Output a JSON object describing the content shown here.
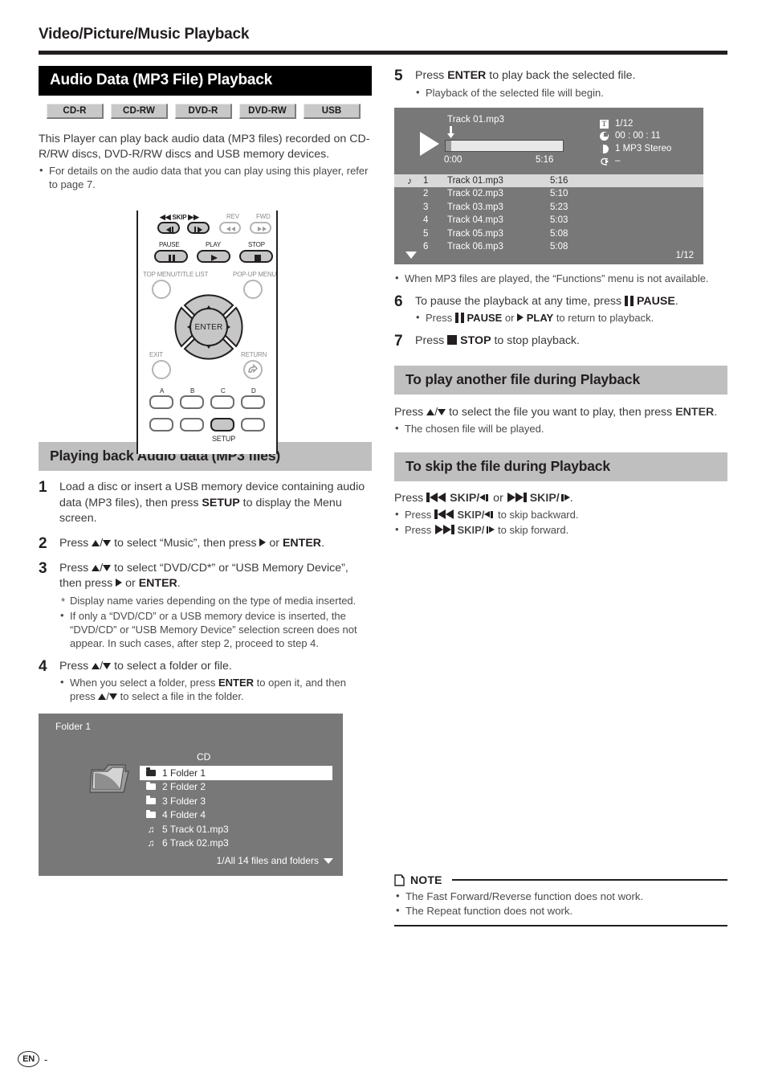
{
  "header": {
    "chapter_title": "Video/Picture/Music Playback"
  },
  "left_column": {
    "section_title": "Audio Data (MP3 File) Playback",
    "media_badges": [
      "CD-R",
      "CD-RW",
      "DVD-R",
      "DVD-RW",
      "USB"
    ],
    "intro_paragraph": "This Player can play back audio data (MP3 files) recorded on CD-R/RW discs, DVD-R/RW discs and USB memory devices.",
    "intro_bullets": [
      "For details on the audio data that you can play using this player, refer to page 7."
    ],
    "remote": {
      "labels": {
        "skip": "SKIP",
        "rev": "REV",
        "fwd": "FWD",
        "pause": "PAUSE",
        "play": "PLAY",
        "stop": "STOP",
        "top_menu": "TOP MENU/TITLE LIST",
        "popup_menu": "POP-UP MENU",
        "exit": "EXIT",
        "return": "RETURN",
        "enter": "ENTER",
        "setup": "SETUP",
        "color_a": "A",
        "color_b": "B",
        "color_c": "C",
        "color_d": "D"
      }
    },
    "procedure_title": "Playing back Audio data (MP3 files)",
    "steps": [
      {
        "num": "1",
        "text_parts": [
          {
            "t": "Load a disc or insert a USB memory device containing audio data (MP3 files), then press ",
            "b": false
          },
          {
            "t": "SETUP",
            "b": true
          },
          {
            "t": " to display the Menu screen.",
            "b": false
          }
        ]
      },
      {
        "num": "2",
        "text_parts": [
          {
            "t": "Press ",
            "b": false
          },
          {
            "t": "__UP__",
            "b": false
          },
          {
            "t": "/",
            "b": false
          },
          {
            "t": "__DOWN__",
            "b": false
          },
          {
            "t": " to select “Music”, then press ",
            "b": false
          },
          {
            "t": "__RIGHT__",
            "b": false
          },
          {
            "t": " or ",
            "b": false
          },
          {
            "t": "ENTER",
            "b": true
          },
          {
            "t": ".",
            "b": false
          }
        ]
      },
      {
        "num": "3",
        "text_parts": [
          {
            "t": "Press ",
            "b": false
          },
          {
            "t": "__UP__",
            "b": false
          },
          {
            "t": "/",
            "b": false
          },
          {
            "t": "__DOWN__",
            "b": false
          },
          {
            "t": " to select “DVD/CD*” or “USB Memory Device”, then press ",
            "b": false
          },
          {
            "t": "__RIGHT__",
            "b": false
          },
          {
            "t": " or ",
            "b": false
          },
          {
            "t": "ENTER",
            "b": true
          },
          {
            "t": ".",
            "b": false
          }
        ],
        "sub_star": "Display name varies depending on the type of media inserted.",
        "sub_bullets": [
          "If only a “DVD/CD” or a USB memory device is inserted, the “DVD/CD” or “USB Memory Device” selection screen does not appear. In such cases, after step 2, proceed to step 4."
        ]
      },
      {
        "num": "4",
        "text_parts": [
          {
            "t": "Press ",
            "b": false
          },
          {
            "t": "__UP__",
            "b": false
          },
          {
            "t": "/",
            "b": false
          },
          {
            "t": "__DOWN__",
            "b": false
          },
          {
            "t": " to select a folder or file.",
            "b": false
          }
        ],
        "sub_bullets_rich": [
          [
            {
              "t": "When you select a folder, press ",
              "b": false
            },
            {
              "t": "ENTER",
              "b": true
            },
            {
              "t": " to open it, and then press ",
              "b": false
            },
            {
              "t": "__UP__",
              "b": false
            },
            {
              "t": "/",
              "b": false
            },
            {
              "t": "__DOWN__",
              "b": false
            },
            {
              "t": " to select a file in the folder.",
              "b": false
            }
          ]
        ]
      }
    ],
    "folder_osd": {
      "title": "Folder 1",
      "source_label": "CD",
      "rows": [
        {
          "icon": "folder-icon",
          "label": "1 Folder 1",
          "selected": true
        },
        {
          "icon": "folder-icon",
          "label": "2 Folder 2",
          "selected": false
        },
        {
          "icon": "folder-icon",
          "label": "3 Folder 3",
          "selected": false
        },
        {
          "icon": "folder-icon",
          "label": "4 Folder 4",
          "selected": false
        },
        {
          "icon": "music-note-icon",
          "label": "5 Track 01.mp3",
          "selected": false
        },
        {
          "icon": "music-note-icon",
          "label": "6 Track 02.mp3",
          "selected": false
        }
      ],
      "footer": "1/All 14 files and folders"
    }
  },
  "right_column": {
    "steps": [
      {
        "num": "5",
        "text_parts": [
          {
            "t": "Press ",
            "b": false
          },
          {
            "t": "ENTER",
            "b": true
          },
          {
            "t": " to play back the selected file.",
            "b": false
          }
        ],
        "sub_bullets": [
          "Playback of the selected file will begin."
        ]
      }
    ],
    "player_osd": {
      "now_playing": "Track 01.mp3",
      "time_elapsed": "0:00",
      "time_total": "5:16",
      "progress_percent": 5,
      "info": [
        {
          "icon": "title-icon",
          "value": "1/12"
        },
        {
          "icon": "elapsed-time-icon",
          "value": "00 : 00 : 11"
        },
        {
          "icon": "audio-track-icon",
          "value": "1  MP3 Stereo"
        },
        {
          "icon": "repeat-icon",
          "value": "–"
        }
      ],
      "tracks": [
        {
          "index": "1",
          "name": "Track 01.mp3",
          "duration": "5:16",
          "selected": true
        },
        {
          "index": "2",
          "name": "Track 02.mp3",
          "duration": "5:10",
          "selected": false
        },
        {
          "index": "3",
          "name": "Track 03.mp3",
          "duration": "5:23",
          "selected": false
        },
        {
          "index": "4",
          "name": "Track 04.mp3",
          "duration": "5:03",
          "selected": false
        },
        {
          "index": "5",
          "name": "Track 05.mp3",
          "duration": "5:08",
          "selected": false
        },
        {
          "index": "6",
          "name": "Track 06.mp3",
          "duration": "5:08",
          "selected": false
        }
      ],
      "page_indicator": "1/12"
    },
    "osd_note_bullets": [
      "When MP3 files are played, the “Functions” menu is not available."
    ],
    "steps_cont": [
      {
        "num": "6",
        "text_parts": [
          {
            "t": "To pause the playback at any time, press ",
            "b": false
          },
          {
            "t": "__PAUSE__",
            "b": false
          },
          {
            "t": " ",
            "b": false
          },
          {
            "t": "PAUSE",
            "b": true
          },
          {
            "t": ".",
            "b": false
          }
        ],
        "sub_bullets_rich": [
          [
            {
              "t": "Press ",
              "b": false
            },
            {
              "t": "__PAUSE__",
              "b": false
            },
            {
              "t": " ",
              "b": false
            },
            {
              "t": "PAUSE",
              "b": true
            },
            {
              "t": " or ",
              "b": false
            },
            {
              "t": "__PLAY__",
              "b": false
            },
            {
              "t": " ",
              "b": false
            },
            {
              "t": "PLAY",
              "b": true
            },
            {
              "t": " to return to playback.",
              "b": false
            }
          ]
        ]
      },
      {
        "num": "7",
        "text_parts": [
          {
            "t": "Press ",
            "b": false
          },
          {
            "t": "__STOP__",
            "b": false
          },
          {
            "t": " ",
            "b": false
          },
          {
            "t": "STOP",
            "b": true
          },
          {
            "t": " to stop playback.",
            "b": false
          }
        ]
      }
    ],
    "play_another_title": "To play another file during Playback",
    "play_another_body_parts": [
      {
        "t": "Press ",
        "b": false
      },
      {
        "t": "__UP__",
        "b": false
      },
      {
        "t": "/",
        "b": false
      },
      {
        "t": "__DOWN__",
        "b": false
      },
      {
        "t": " to select the file you want to play, then press ",
        "b": false
      },
      {
        "t": "ENTER",
        "b": true
      },
      {
        "t": ".",
        "b": false
      }
    ],
    "play_another_bullets": [
      "The chosen file will be played."
    ],
    "skip_title": "To skip the file during Playback",
    "skip_body_parts": [
      {
        "t": "Press ",
        "b": false
      },
      {
        "t": "__SKIPPREV__",
        "b": false
      },
      {
        "t": "  ",
        "b": false
      },
      {
        "t": "SKIP/",
        "b": true
      },
      {
        "t": "__PREVSM__",
        "b": false
      },
      {
        "t": " or ",
        "b": false
      },
      {
        "t": "__SKIPNEXT__",
        "b": false
      },
      {
        "t": "  ",
        "b": false
      },
      {
        "t": "SKIP/",
        "b": true
      },
      {
        "t": "__NEXTSM__",
        "b": false
      },
      {
        "t": ".",
        "b": false
      }
    ],
    "skip_bullets_rich": [
      [
        {
          "t": "Press ",
          "b": false
        },
        {
          "t": "__SKIPPREV__",
          "b": false
        },
        {
          "t": "  ",
          "b": false
        },
        {
          "t": "SKIP/",
          "b": true
        },
        {
          "t": "__PREVSM__",
          "b": false
        },
        {
          "t": " to skip backward.",
          "b": false
        }
      ],
      [
        {
          "t": "Press ",
          "b": false
        },
        {
          "t": "__SKIPNEXT__",
          "b": false
        },
        {
          "t": "  ",
          "b": false
        },
        {
          "t": "SKIP/",
          "b": true
        },
        {
          "t": "__NEXTSM__",
          "b": false
        },
        {
          "t": " to skip forward.",
          "b": false
        }
      ]
    ],
    "note": {
      "label": "NOTE",
      "bullets": [
        "The Fast Forward/Reverse function does not work.",
        "The Repeat function does not work."
      ]
    }
  },
  "footer": {
    "language_badge": "EN",
    "page_number": "-"
  },
  "colors": {
    "section_bar_black": "#000000",
    "section_bar_gray": "#bfbfbf",
    "osd_background": "#787878",
    "osd_selected_row": "#d9d9d9",
    "badge_face": "#c8c8c8",
    "text": "#231f20"
  }
}
